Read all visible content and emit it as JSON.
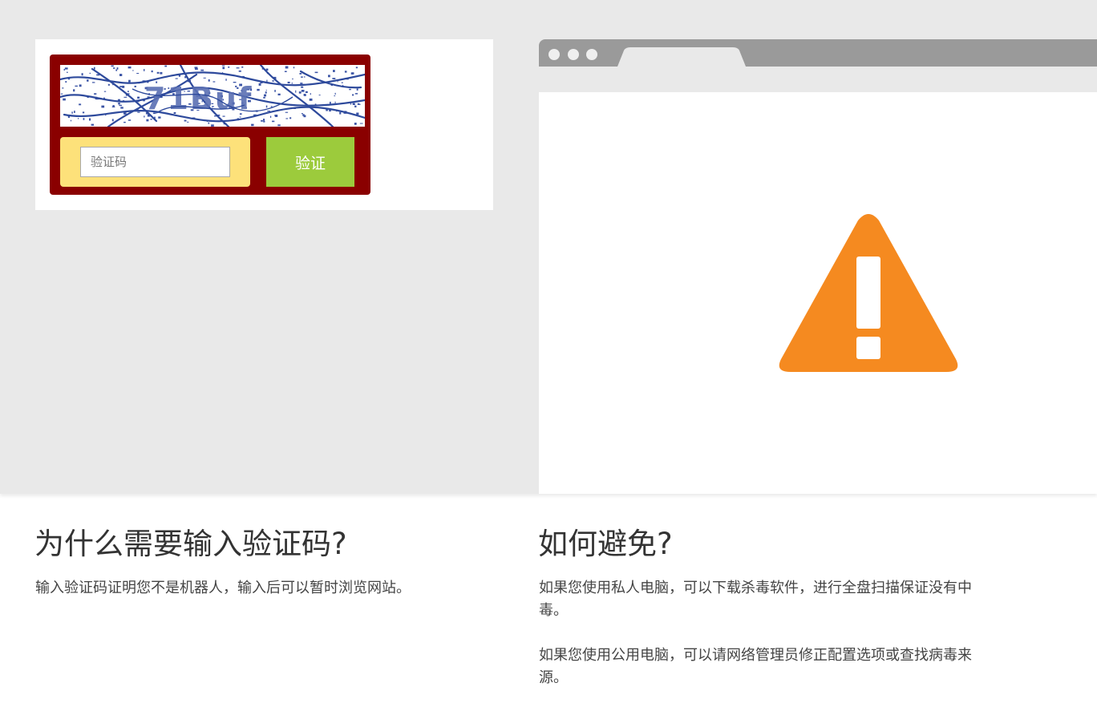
{
  "captcha": {
    "image_text": "71Buf",
    "input_placeholder": "验证码",
    "verify_label": "验证"
  },
  "why_section": {
    "heading": "为什么需要输入验证码?",
    "body": "输入验证码证明您不是机器人，输入后可以暂时浏览网站。"
  },
  "avoid_section": {
    "heading": "如何避免?",
    "body_private": "如果您使用私人电脑，可以下载杀毒软件，进行全盘扫描保证没有中毒。",
    "body_public": "如果您使用公用电脑，可以请网络管理员修正配置选项或查找病毒来源。"
  },
  "icons": {
    "warning": "warning-triangle-icon"
  },
  "colors": {
    "captcha_frame": "#8a0000",
    "input_background": "#fde17a",
    "verify_button": "#9ccb3c",
    "warning": "#f58a20",
    "band_background": "#e9e9e9",
    "browser_chrome": "#9a9a9a"
  }
}
